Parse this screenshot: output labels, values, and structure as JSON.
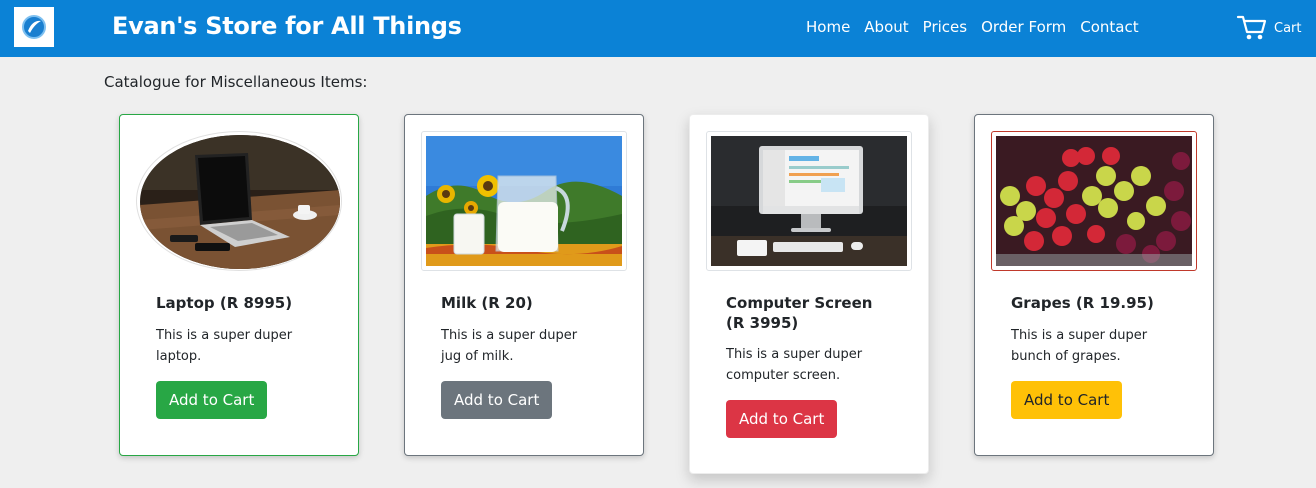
{
  "navbar": {
    "brand": "Evan's Store for All Things",
    "logo_icon": "logo-icon",
    "links": [
      "Home",
      "About",
      "Prices",
      "Order Form",
      "Contact"
    ],
    "cart_label": "Cart",
    "cart_icon": "cart-icon",
    "background_color": "#0b82d6"
  },
  "catalogue": {
    "title": "Catalogue for Miscellaneous Items:"
  },
  "products": [
    {
      "title": "Laptop (R 8995)",
      "description": "This is a super duper laptop.",
      "button_label": "Add to Cart",
      "image": "laptop-image",
      "button_color": "#28a745"
    },
    {
      "title": "Milk (R 20)",
      "description": "This is a super duper jug of milk.",
      "button_label": "Add to Cart",
      "image": "milk-image",
      "button_color": "#6c757d"
    },
    {
      "title": "Computer Screen (R 3995)",
      "description": "This is a super duper computer screen.",
      "button_label": "Add to Cart",
      "image": "computer-screen-image",
      "button_color": "#dc3545"
    },
    {
      "title": "Grapes (R 19.95)",
      "description": "This is a super duper bunch of grapes.",
      "button_label": "Add to Cart",
      "image": "grapes-image",
      "button_color": "#ffc107"
    }
  ]
}
